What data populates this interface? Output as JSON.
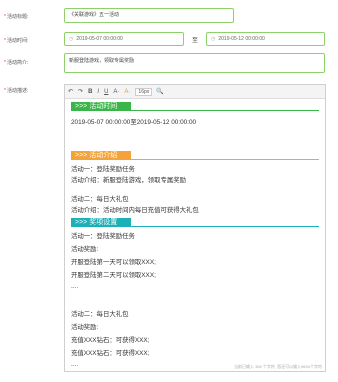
{
  "form": {
    "name_label": "活动标题:",
    "name_value": "《关联游戏》五一活动",
    "time_label": "活动时间:",
    "start_time": "2019-05-07 00:00:00",
    "time_sep": "至",
    "end_time": "2019-05-12 00:00:00",
    "intro_label": "活动简介:",
    "intro_value": "新服登陆游戏，领取专属奖励",
    "desc_label": "活动描述:"
  },
  "toolbar": {
    "undo": "↶",
    "redo": "↷",
    "bold": "B",
    "italic": "I",
    "underline": "U",
    "font_color": "A·",
    "bg_color": "A·",
    "size": "16px",
    "link": "🔍"
  },
  "sections": {
    "time_title": ">>> 活动时间",
    "time_text": "2019-05-07 00:00:00至2019-05-12 00:00:00",
    "intro_title": ">>> 活动介绍",
    "intro_lines": [
      "活动一：登陆奖励任务",
      "活动介绍：新服登陆游戏，领取专属奖励",
      "活动二：每日大礼包",
      "活动介绍：活动时间内每日充值可获得大礼包"
    ],
    "reward_title": ">>> 奖项设置",
    "reward_lines": [
      "活动一：登陆奖励任务",
      "活动奖励:",
      "开服登陆第一天可以领取XXX;",
      "开服登陆第二天可以领取XXX;",
      "....",
      "活动二：每日大礼包",
      "活动奖励:",
      "充值XXX钻石：可获得XXX;",
      "充值XXX钻石：可获得XXX;",
      "...."
    ]
  },
  "footer": "当前已输入 306 个字符, 您还可以输入9694个字符"
}
